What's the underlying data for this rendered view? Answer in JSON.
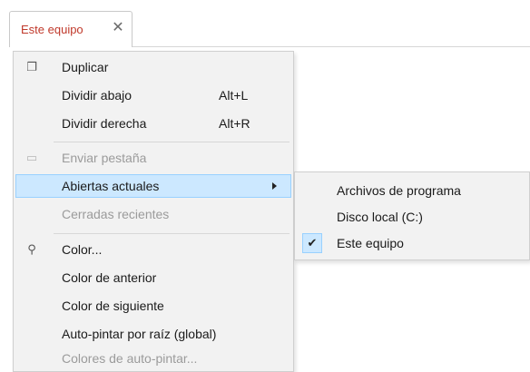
{
  "tab": {
    "title": "Este equipo",
    "close_glyph": "✕"
  },
  "menu": {
    "items": [
      {
        "label": "Duplicar",
        "icon": "duplicate-window-icon",
        "icon_glyph": "❐"
      },
      {
        "label": "Dividir abajo",
        "shortcut": "Alt+L"
      },
      {
        "label": "Dividir derecha",
        "shortcut": "Alt+R"
      },
      {
        "label": "Enviar pestaña",
        "icon": "send-tab-icon",
        "icon_glyph": "▭",
        "disabled": true
      },
      {
        "label": "Abiertas actuales",
        "has_submenu": true,
        "highlighted": true
      },
      {
        "label": "Cerradas recientes",
        "disabled": true
      },
      {
        "label": "Color...",
        "icon": "search-icon",
        "icon_glyph": "⚲"
      },
      {
        "label": "Color de anterior"
      },
      {
        "label": "Color de siguiente"
      },
      {
        "label": "Auto-pintar por raíz (global)"
      },
      {
        "label": "Colores de auto-pintar...",
        "disabled": true
      }
    ]
  },
  "submenu": {
    "items": [
      {
        "label": "Archivos de programa"
      },
      {
        "label": "Disco local (C:)"
      },
      {
        "label": "Este equipo",
        "checked": true,
        "check_glyph": "✔"
      }
    ]
  },
  "colors": {
    "tab_title": "#c0392b",
    "highlight_bg": "#cce8ff",
    "highlight_border": "#99d1ff",
    "menu_bg": "#f2f2f2",
    "disabled_text": "#9b9b9b"
  }
}
